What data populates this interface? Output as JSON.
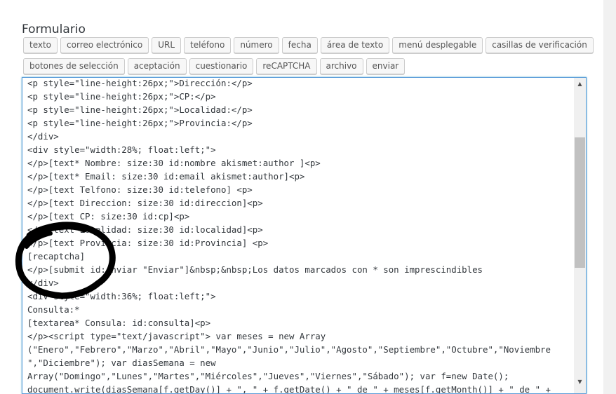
{
  "form": {
    "title": "Formulario",
    "tags_row1": [
      "texto",
      "correo electrónico",
      "URL",
      "teléfono",
      "número",
      "fecha",
      "área de texto",
      "menú desplegable",
      "casillas de verificación"
    ],
    "tags_row2": [
      "botones de selección",
      "aceptación",
      "cuestionario",
      "reCAPTCHA",
      "archivo",
      "enviar"
    ]
  },
  "editor": {
    "lines": [
      "<p style=\"line-height:26px;\">Dirección:</p>",
      "<p style=\"line-height:26px;\">CP:</p>",
      "<p style=\"line-height:26px;\">Localidad:</p>",
      "<p style=\"line-height:26px;\">Provincia:</p>",
      "</div>",
      "<div style=\"width:28%; float:left;\">",
      "</p>[text* Nombre: size:30 id:nombre akismet:author ]<p>",
      "</p>[text* Email: size:30 id:email akismet:author]<p>",
      "</p>[text Telfono: size:30 id:telefono] <p>",
      "</p>[text Direccion: size:30 id:direccion]<p>",
      "</p>[text CP: size:30 id:cp]<p>",
      "</p>[text Localidad: size:30 id:localidad]<p>",
      "</p>[text Provincia: size:30 id:Provincia] <p>",
      "[recaptcha]",
      "</p>[submit id:enviar \"Enviar\"]&nbsp;&nbsp;Los datos marcados con * son imprescindibles",
      "</div>",
      "<div style=\"width:36%; float:left;\">",
      "Consulta:*",
      "[textarea* Consula: id:consulta]<p>",
      "</p><script type=\"text/javascript\"> var meses = new Array",
      "(\"Enero\",\"Febrero\",\"Marzo\",\"Abril\",\"Mayo\",\"Junio\",\"Julio\",\"Agosto\",\"Septiembre\",\"Octubre\",\"Noviembre",
      "\",\"Diciembre\"); var diasSemana = new",
      "Array(\"Domingo\",\"Lunes\",\"Martes\",\"Miércoles\",\"Jueves\",\"Viernes\",\"Sábado\"); var f=new Date();",
      "document.write(diasSemana[f.getDay()] + \", \" + f.getDate() + \" de \" + meses[f.getMonth()] + \" de \" +"
    ]
  },
  "scrollbar": {
    "up_icon": "arrow-up-icon",
    "down_icon": "arrow-down-icon",
    "up_glyph": "▲",
    "down_glyph": "▼"
  },
  "annotation": {
    "color": "#000000",
    "description_icon": "hand-drawn-circle"
  }
}
